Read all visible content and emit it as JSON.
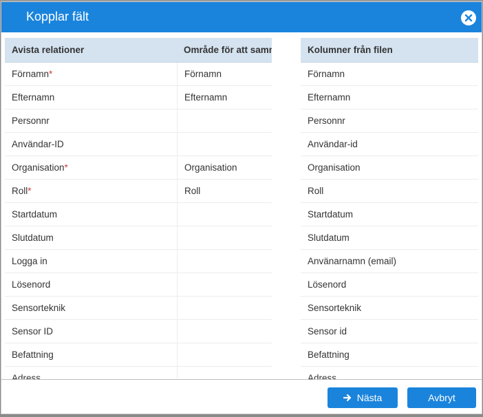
{
  "dialog": {
    "title": "Kopplar fält",
    "close_icon": "close-icon"
  },
  "left_table": {
    "headers": [
      "Avista relationer",
      "Område för att samma"
    ],
    "rows": [
      {
        "name": "Förnamn",
        "required": "*",
        "mapped": "Förnamn"
      },
      {
        "name": "Efternamn",
        "required": "",
        "mapped": "Efternamn"
      },
      {
        "name": "Personnr",
        "required": "",
        "mapped": ""
      },
      {
        "name": "Användar-ID",
        "required": "",
        "mapped": ""
      },
      {
        "name": "Organisation",
        "required": "*",
        "mapped": "Organisation"
      },
      {
        "name": "Roll",
        "required": "*",
        "mapped": "Roll"
      },
      {
        "name": "Startdatum",
        "required": "",
        "mapped": ""
      },
      {
        "name": "Slutdatum",
        "required": "",
        "mapped": ""
      },
      {
        "name": "Logga in",
        "required": "",
        "mapped": ""
      },
      {
        "name": "Lösenord",
        "required": "",
        "mapped": ""
      },
      {
        "name": "Sensorteknik",
        "required": "",
        "mapped": ""
      },
      {
        "name": "Sensor ID",
        "required": "",
        "mapped": ""
      },
      {
        "name": "Befattning",
        "required": "",
        "mapped": ""
      },
      {
        "name": "Adress",
        "required": "",
        "mapped": ""
      }
    ]
  },
  "right_table": {
    "header": "Kolumner från filen",
    "rows": [
      "Förnamn",
      "Efternamn",
      "Personnr",
      "Användar-id",
      "Organisation",
      "Roll",
      "Startdatum",
      "Slutdatum",
      "Använarnamn (email)",
      "Lösenord",
      "Sensorteknik",
      "Sensor id",
      "Befattning",
      "Adress"
    ]
  },
  "footer": {
    "next_label": "Nästa",
    "next_icon": "arrow-right-icon",
    "cancel_label": "Avbryt"
  },
  "colors": {
    "primary": "#1a84dc",
    "header_bg": "#d5e3f0",
    "required": "#d23b3b"
  }
}
